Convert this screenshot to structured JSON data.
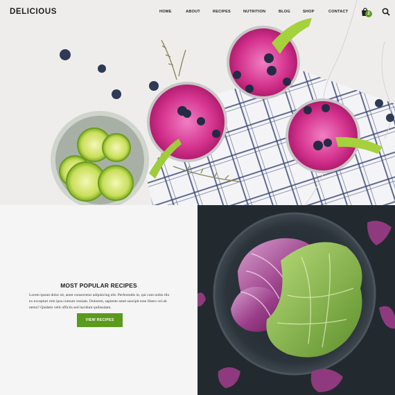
{
  "header": {
    "logo": "DELICIOUS",
    "nav": [
      {
        "label": "HOME"
      },
      {
        "label": "ABOUT"
      },
      {
        "label": "RECIPES"
      },
      {
        "label": "NUTRITION"
      },
      {
        "label": "BLOG"
      },
      {
        "label": "SHOP"
      },
      {
        "label": "CONTACT"
      }
    ],
    "cart_count": "2",
    "cart_icon": "shopping-bag-icon",
    "search_icon": "search-icon"
  },
  "promo": {
    "title": "MOST POPULAR RECIPES",
    "body": "Lorem ipsum dolor sit, amet consectetur adipisicing elit. Perferendis in, qui cum nobis illo ex excepturi rem ipsa cumum veniam. Dolorem, sapiente amet suscipit esse libero vel ab nemo? Quidem velit officiis sed incidunt quibusdam.",
    "button": "VIEW RECIPES"
  },
  "colors": {
    "accent": "#5a9a1c",
    "badge": "#5f9e1e",
    "dark_bg": "#232a2f"
  }
}
